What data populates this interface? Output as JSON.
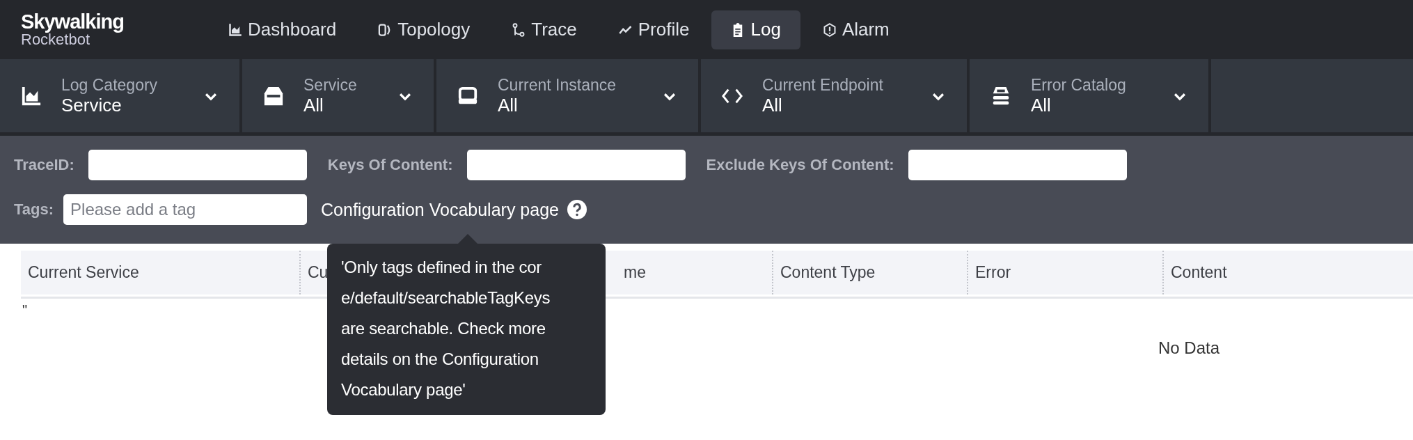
{
  "logo": {
    "title": "Skywalking",
    "subtitle": "Rocketbot"
  },
  "nav": [
    {
      "label": "Dashboard",
      "kind": "chart",
      "selected": false
    },
    {
      "label": "Topology",
      "kind": "topology",
      "selected": false
    },
    {
      "label": "Trace",
      "kind": "trace",
      "selected": false
    },
    {
      "label": "Profile",
      "kind": "profile",
      "selected": false
    },
    {
      "label": "Log",
      "kind": "clipboard",
      "selected": true
    },
    {
      "label": "Alarm",
      "kind": "alarm",
      "selected": false
    }
  ],
  "selectors": [
    {
      "label": "Log Category",
      "value": "Service",
      "kind": "chart"
    },
    {
      "label": "Service",
      "value": "All",
      "kind": "box"
    },
    {
      "label": "Current Instance",
      "value": "All",
      "kind": "instance"
    },
    {
      "label": "Current Endpoint",
      "value": "All",
      "kind": "code"
    },
    {
      "label": "Error Catalog",
      "value": "All",
      "kind": "stack"
    }
  ],
  "filters": [
    {
      "label": "TraceID:"
    },
    {
      "label": "Keys Of Content:"
    },
    {
      "label": "Exclude Keys Of Content:"
    }
  ],
  "tags": {
    "label": "Tags:",
    "placeholder": "Please add a tag",
    "link": "Configuration Vocabulary page"
  },
  "tooltip": {
    "lines": [
      "'Only tags defined in the cor",
      "e/default/searchableTagKeys",
      "are searchable. Check more",
      "details on the Configuration",
      "Vocabulary page'"
    ]
  },
  "table": {
    "columns": [
      "Current Service",
      "Cu",
      "me",
      "Content Type",
      "Error",
      "Content"
    ],
    "stray_mark": "\"",
    "empty_text": "No Data"
  }
}
